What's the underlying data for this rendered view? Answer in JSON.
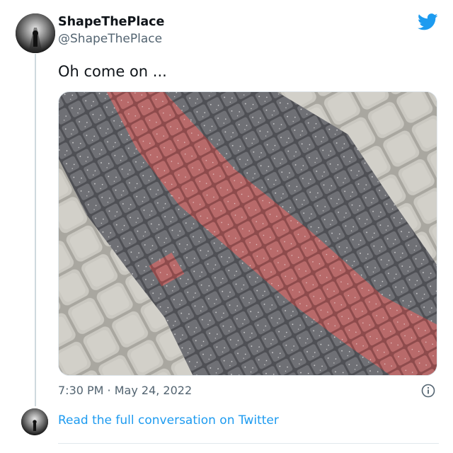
{
  "tweet": {
    "author": {
      "display_name": "ShapeThePlace",
      "handle": "@ShapeThePlace",
      "avatar_icon": "avatar-silhouette-icon"
    },
    "text": "Oh come on ...",
    "media": {
      "subject": "paving-stone-photo",
      "colors": {
        "gray_paver": "#6e6e73",
        "red_paver": "#b56465",
        "light_paver": "#c6c4bd"
      }
    },
    "timestamp": "7:30 PM · May 24, 2022",
    "brand_icon": "twitter-bird-icon",
    "brand_color": "#1d9bf0",
    "info_icon": "info-icon"
  },
  "footer": {
    "link_label": "Read the full conversation on Twitter"
  }
}
